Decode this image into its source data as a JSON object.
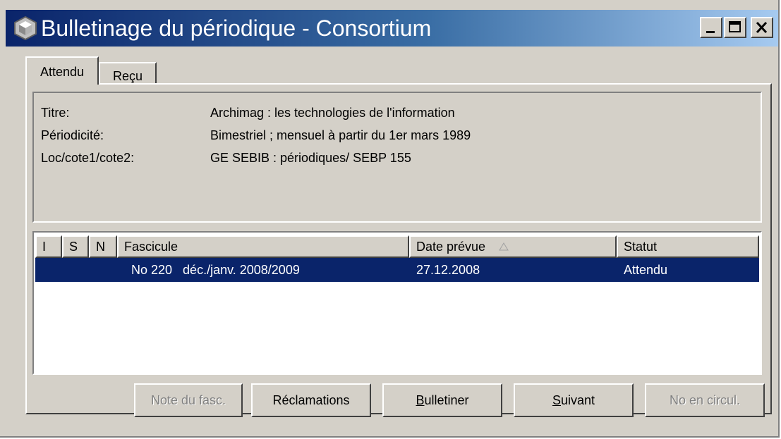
{
  "window": {
    "title": "Bulletinage du périodique - Consortium",
    "controls": {
      "minimize": "_",
      "maximize": "□",
      "close": "×"
    }
  },
  "tabs": [
    {
      "label": "Attendu",
      "active": true
    },
    {
      "label": "Reçu",
      "active": false
    }
  ],
  "info": {
    "fields": [
      {
        "label": "Titre:",
        "value": "Archimag : les technologies de l'information"
      },
      {
        "label": "Périodicité:",
        "value": "Bimestriel ; mensuel à partir du 1er mars 1989"
      },
      {
        "label": "Loc/cote1/cote2:",
        "value": "GE SEBIB : périodiques/ SEBP 155"
      }
    ]
  },
  "list": {
    "columns": [
      "I",
      "S",
      "N",
      "Fascicule",
      "Date prévue",
      "Statut"
    ],
    "sorted_column": "Date prévue",
    "rows": [
      {
        "i": "",
        "s": "",
        "n": "",
        "fascicule": "No 220   déc./janv. 2008/2009",
        "date": "27.12.2008",
        "statut": "Attendu",
        "selected": true
      }
    ]
  },
  "buttons": [
    {
      "label": "Note du fasc.",
      "enabled": false
    },
    {
      "label": "Réclamations",
      "enabled": true
    },
    {
      "label": "Bulletiner",
      "enabled": true,
      "mnemonic": "B"
    },
    {
      "label": "Suivant",
      "enabled": true,
      "mnemonic": "S"
    },
    {
      "label": "No en circul.",
      "enabled": false,
      "mnemonic": "c"
    }
  ],
  "colors": {
    "titlebar_start": "#0a246a",
    "titlebar_end": "#a6caf0",
    "selection": "#0a246a",
    "face": "#d4d0c8"
  },
  "icons": {
    "app": "app-emblem-icon",
    "sort": "sort-ascending-icon"
  }
}
